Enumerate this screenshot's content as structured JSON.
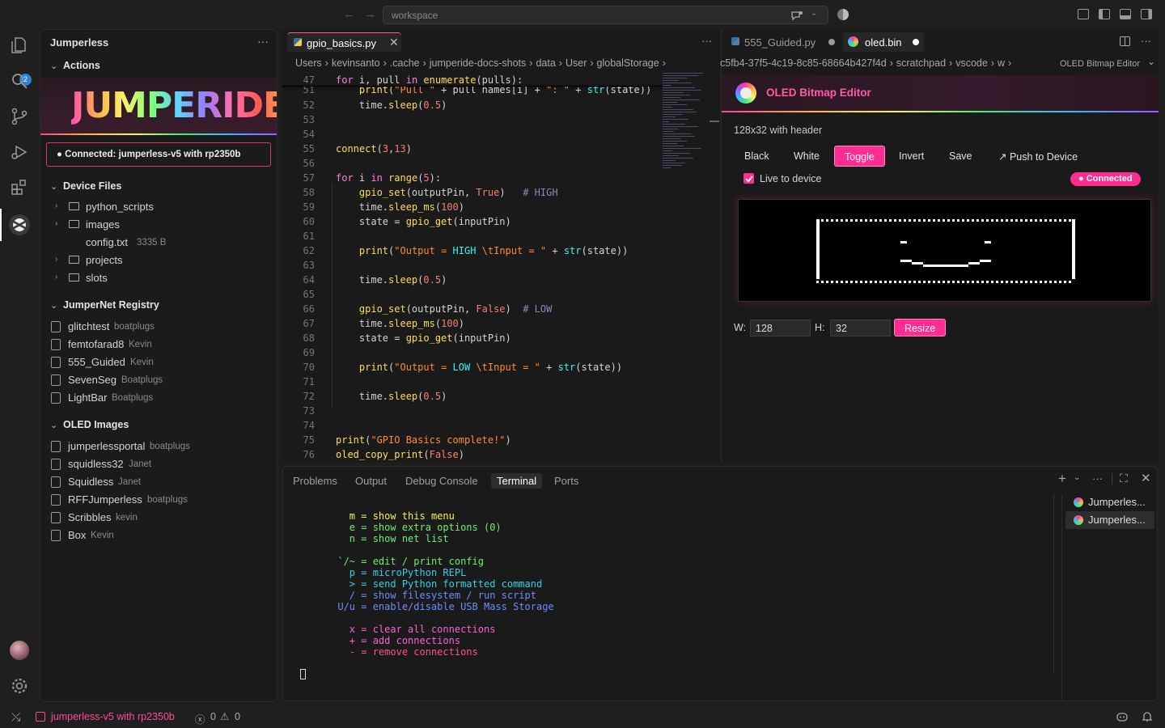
{
  "titlebar": {
    "search": "workspace"
  },
  "activity": {
    "scm_badge": "2"
  },
  "sidebar": {
    "title": "Jumperless",
    "actions_label": "Actions",
    "logo_text": "JUMPERIDE",
    "connection": "● Connected: jumperless-v5 with rp2350b",
    "device_files_label": "Device Files",
    "files": [
      {
        "name": "python_scripts",
        "folder": true,
        "meta": ""
      },
      {
        "name": "images",
        "folder": true,
        "meta": ""
      },
      {
        "name": "config.txt",
        "folder": false,
        "meta": "3335 B"
      },
      {
        "name": "projects",
        "folder": true,
        "meta": ""
      },
      {
        "name": "slots",
        "folder": true,
        "meta": ""
      }
    ],
    "registry_label": "JumperNet Registry",
    "registry": [
      {
        "name": "glitchtest",
        "owner": "boatplugs"
      },
      {
        "name": "femtofarad8",
        "owner": "Kevin"
      },
      {
        "name": "555_Guided",
        "owner": "Kevin"
      },
      {
        "name": "SevenSeg",
        "owner": "Boatplugs"
      },
      {
        "name": "LightBar",
        "owner": "Boatplugs"
      }
    ],
    "oled_label": "OLED Images",
    "oled_images": [
      {
        "name": "jumperlessportal",
        "owner": "boatplugs"
      },
      {
        "name": "squidless32",
        "owner": "Janet"
      },
      {
        "name": "Squidless",
        "owner": "Janet"
      },
      {
        "name": "RFFJumperless",
        "owner": "boatplugs"
      },
      {
        "name": "Scribbles",
        "owner": "kevin"
      },
      {
        "name": "Box",
        "owner": "Kevin"
      }
    ]
  },
  "editor1": {
    "tab": "gpio_basics.py",
    "breadcrumb": [
      "Users",
      "kevinsanto",
      ".cache",
      "jumperide-docs-shots",
      "data",
      "User",
      "globalStorage"
    ],
    "sticky_num": "47",
    "sticky_code": "for i, pull in enumerate(pulls):",
    "lines": [
      "51",
      "52",
      "53",
      "54",
      "55",
      "56",
      "57",
      "58",
      "59",
      "60",
      "61",
      "62",
      "63",
      "64",
      "65",
      "66",
      "67",
      "68",
      "69",
      "70",
      "71",
      "72",
      "73",
      "74",
      "75",
      "76"
    ]
  },
  "editor2": {
    "tabs": [
      "555_Guided.py",
      "oled.bin"
    ],
    "breadcrumb": [
      "c5fb4-37f5-4c19-8c85-68664b427f4d",
      "scratchpad",
      "vscode",
      "w"
    ],
    "breadcrumb_tail": "OLED Bitmap Editor",
    "title": "OLED Bitmap Editor",
    "size_label": "128x32 with header",
    "buttons": [
      "Black",
      "White",
      "Toggle",
      "Invert",
      "Save"
    ],
    "push_label": "↗ Push to Device",
    "live_label": "Live to device",
    "status": "● Connected",
    "w_label": "W:",
    "h_label": "H:",
    "w_value": "128",
    "h_value": "32",
    "resize_label": "Resize"
  },
  "panel": {
    "tabs": [
      "Problems",
      "Output",
      "Debug Console",
      "Terminal",
      "Ports"
    ],
    "terminals": [
      "Jumperles...",
      "Jumperles..."
    ]
  },
  "statusbar": {
    "device": "jumperless-v5 with rp2350b",
    "errors": "0",
    "warnings": "0"
  }
}
